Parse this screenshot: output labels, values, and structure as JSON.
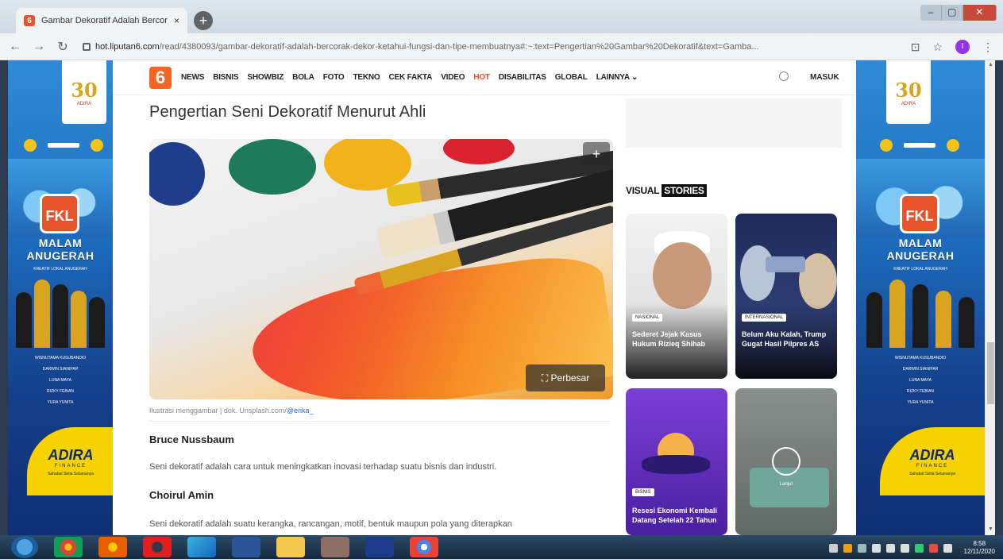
{
  "browser": {
    "tab_title": "Gambar Dekoratif Adalah Bercor",
    "tab_close": "×",
    "new_tab": "+",
    "window_controls": {
      "minimize": "–",
      "maximize": "▢",
      "close": "✕"
    },
    "nav": {
      "back": "←",
      "forward": "→",
      "reload": "↻"
    },
    "url_host": "hot.liputan6.com",
    "url_path": "/read/4380093/gambar-dekoratif-adalah-bercorak-dekor-ketahui-fungsi-dan-tipe-membuatnya#:~:text=Pengertian%20Gambar%20Dekoratif&text=Gamba...",
    "profile_initial": "I"
  },
  "site": {
    "logo": "6",
    "nav_items": [
      "NEWS",
      "BISNIS",
      "SHOWBIZ",
      "BOLA",
      "FOTO",
      "TEKNO",
      "CEK FAKTA",
      "VIDEO",
      "HOT",
      "DISABILITAS",
      "GLOBAL",
      "LAINNYA ⌄"
    ],
    "login": "MASUK"
  },
  "article": {
    "title": "Pengertian Seni Dekoratif Menurut Ahli",
    "zoom_label": "⛶ Perbesar",
    "caption_prefix": "Ilustrasi menggambar | dok. Unsplash.com/",
    "caption_handle": "@erika_",
    "experts": [
      {
        "name": "Bruce Nussbaum",
        "text": "Seni dekoratif adalah cara untuk meningkatkan inovasi terhadap suatu bisnis dan industri."
      },
      {
        "name": "Choirul Amin",
        "text": "Seni dekoratif adalah suatu kerangka, rancangan, motif, bentuk maupun pola yang diterapkan"
      }
    ]
  },
  "rail": {
    "visual_stories_prefix": "VISUAL",
    "visual_stories_highlight": "STORIES",
    "stories": [
      {
        "tag": "NASIONAL",
        "title": "Sederet Jejak Kasus Hukum Rizieq Shihab"
      },
      {
        "tag": "INTERNASIONAL",
        "title": "Belum Aku Kalah, Trump Gugat Hasil Pilpres AS"
      },
      {
        "tag": "BISNIS",
        "title": "Resesi Ekonomi Kembali Datang Setelah 22 Tahun"
      },
      {
        "tag": "",
        "title": "",
        "play_label": "Lanjut"
      }
    ]
  },
  "banner": {
    "logo_number": "30",
    "logo_sub": "ADIRA",
    "fkl": "FKL",
    "title_line1": "MALAM",
    "title_line2": "ANUGERAH",
    "subtitle": "KREATIF LOKAL ANUGERAH",
    "names": [
      "WISNUTAMA KUSUBANDIO",
      "DARWIN SIANIPAR",
      "LUNA MAYA",
      "RIZKY FEBIAN",
      "YURA YUNITA"
    ],
    "adira": "ADIRA",
    "adira_sub": "FINANCE",
    "adira_tag": "Sahabat Setia Selamanya"
  },
  "taskbar": {
    "time": "8:58",
    "date": "12/11/2020"
  }
}
